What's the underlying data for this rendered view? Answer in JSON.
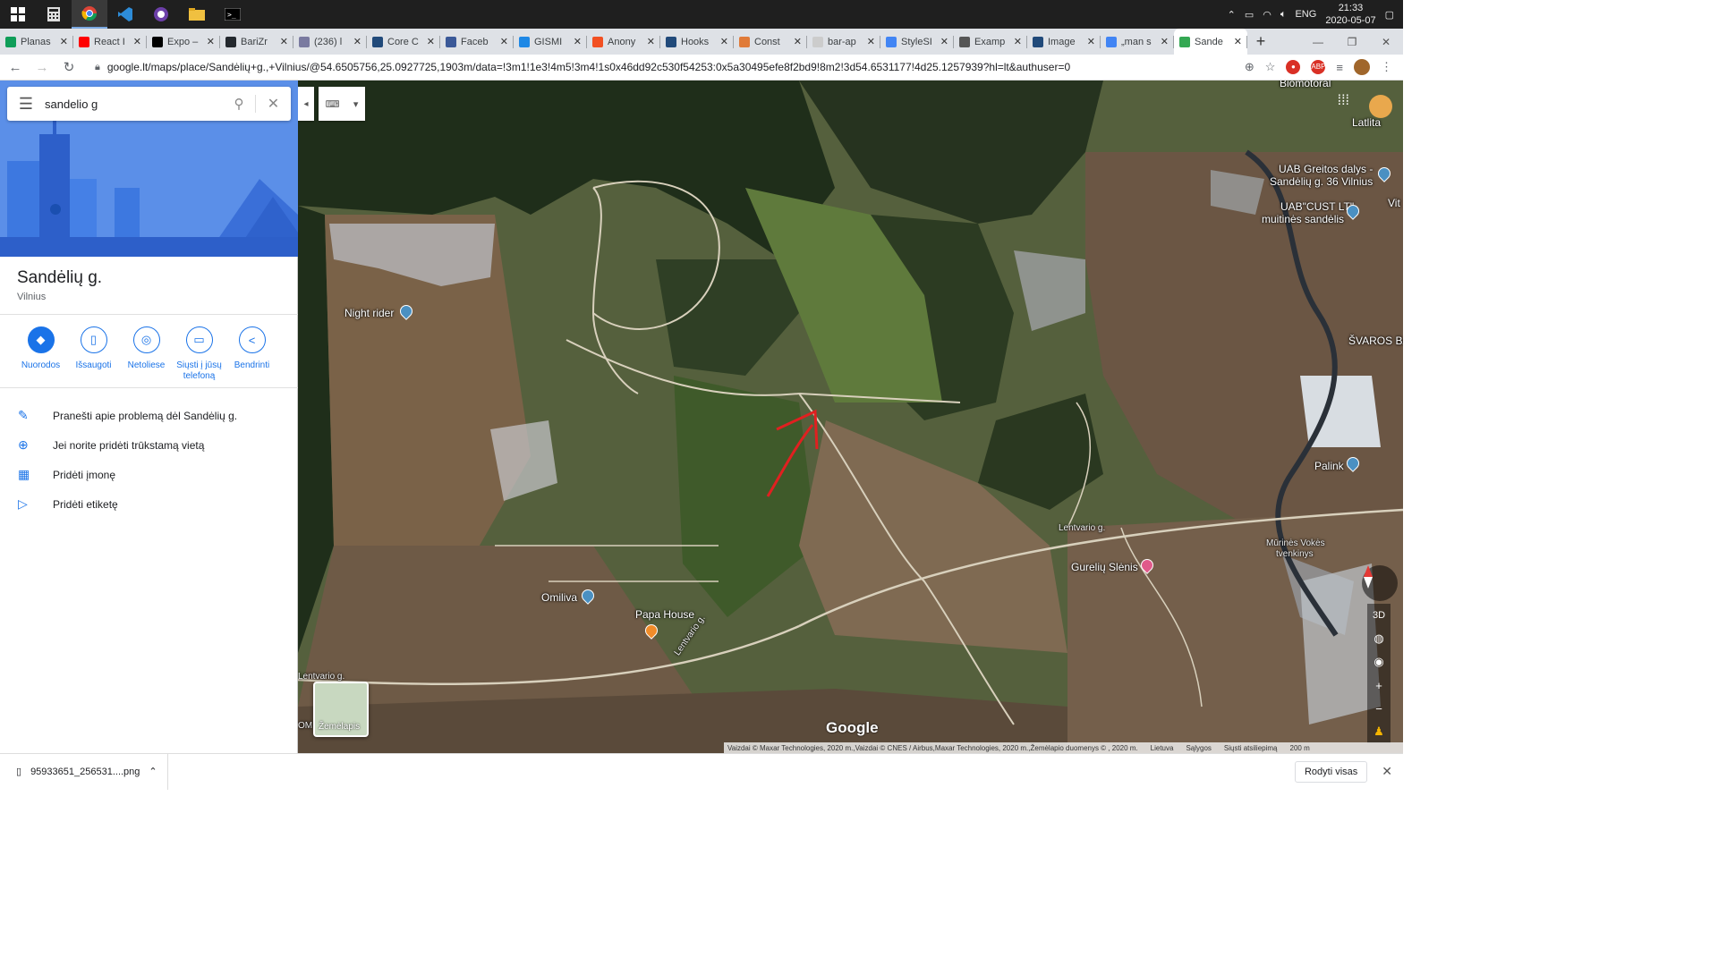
{
  "taskbar": {
    "time": "21:33",
    "date": "2020-05-07",
    "lang": "ENG"
  },
  "tabs": [
    {
      "label": "Planas",
      "color": "#0f9d58"
    },
    {
      "label": "React I",
      "color": "#ff0000"
    },
    {
      "label": "Expo –",
      "color": "#000000"
    },
    {
      "label": "BariZr",
      "color": "#24292e"
    },
    {
      "label": "(236) l",
      "color": "#7a7aa0"
    },
    {
      "label": "Core C",
      "color": "#214a7a"
    },
    {
      "label": "Faceb",
      "color": "#3b5998"
    },
    {
      "label": "GISMI",
      "color": "#1e88e5"
    },
    {
      "label": "Anony",
      "color": "#f25022"
    },
    {
      "label": "Hooks",
      "color": "#214a7a"
    },
    {
      "label": "Const",
      "color": "#e07b39"
    },
    {
      "label": "bar-ap",
      "color": "#cccccc"
    },
    {
      "label": "StyleSI",
      "color": "#4285f4"
    },
    {
      "label": "Examp",
      "color": "#555555"
    },
    {
      "label": "Image",
      "color": "#214a7a"
    },
    {
      "label": "„man s",
      "color": "#4285f4"
    },
    {
      "label": "Sande",
      "color": "#34a853",
      "active": true
    }
  ],
  "url": "google.lt/maps/place/Sandėlių+g.,+Vilnius/@54.6505756,25.0927725,1903m/data=!3m1!1e3!4m5!3m4!1s0x46dd92c530f54253:0x5a30495efe8f2bd9!8m2!3d54.6531177!4d25.1257939?hl=lt&authuser=0",
  "search": {
    "value": "sandelio g"
  },
  "place": {
    "title": "Sandėlių g.",
    "subtitle": "Vilnius"
  },
  "actions": [
    {
      "label": "Nuorodos",
      "icon": "directions-icon"
    },
    {
      "label": "Išsaugoti",
      "icon": "bookmark-icon"
    },
    {
      "label": "Netoliese",
      "icon": "nearby-icon"
    },
    {
      "label": "Siųsti į jūsų telefoną",
      "icon": "send-to-phone-icon"
    },
    {
      "label": "Bendrinti",
      "icon": "share-icon"
    }
  ],
  "links": [
    {
      "label": "Pranešti apie problemą dėl Sandėlių g.",
      "icon": "pencil-icon"
    },
    {
      "label": "Jei norite pridėti trūkstamą vietą",
      "icon": "add-place-icon"
    },
    {
      "label": "Pridėti įmonę",
      "icon": "add-business-icon"
    },
    {
      "label": "Pridėti etiketę",
      "icon": "label-icon"
    }
  ],
  "map": {
    "labels": {
      "night_rider": "Night rider",
      "biomotoral": "Biomotoral",
      "latlita": "Latlita",
      "uab_greitos1": "UAB Greitos dalys -",
      "uab_greitos2": "Sandėlių g. 36 Vilnius",
      "uab_cust1": "UAB\"CUST LT\"",
      "uab_cust2": "muitinės sandėlis",
      "vit": "Vit",
      "svaros": "ŠVAROS BA",
      "palink": "Palink",
      "lentvario1": "Lentvario g.",
      "lentvario2": "Lentvario g.",
      "lentvario3": "Lentvario g.",
      "gureliu": "Gurelių Slėnis",
      "murines1": "Mūrinės Vokės",
      "murines2": "tvenkinys",
      "omiliva": "Omiliva",
      "papa": "Papa House",
      "om": "OM"
    },
    "layer_label": "Žemėlapis",
    "logo": "Google",
    "three_d": "3D",
    "attribution": "Vaizdai © Maxar Technologies, 2020 m.,Vaizdai © CNES / Airbus,Maxar Technologies, 2020 m.,Žemėlapio duomenys © , 2020 m.",
    "country": "Lietuva",
    "terms": "Sąlygos",
    "feedback": "Siųsti atsiliepimą",
    "scale": "200 m"
  },
  "download": {
    "filename": "95933651_256531....png",
    "show_all": "Rodyti visas"
  }
}
